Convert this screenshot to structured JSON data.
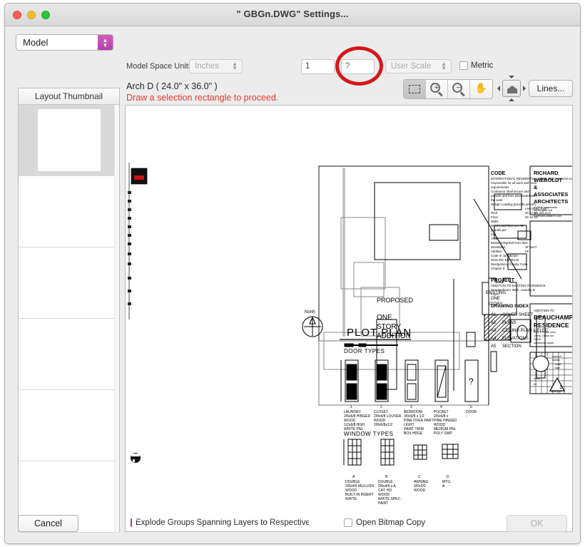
{
  "window": {
    "title": "\" GBGn.DWG\" Settings...",
    "traffic_lights": [
      "close-button",
      "minimize-button",
      "zoom-button"
    ]
  },
  "toolbar": {
    "layout_select_value": "Model",
    "model_space_units_label": "Model Space Units",
    "units_value": "Inches",
    "scale_numerator": "1",
    "scale_denominator": "?",
    "user_scale_value": "User Scale",
    "metric_label": "Metric",
    "metric_checked": false,
    "lines_button": "Lines...",
    "tools": [
      {
        "name": "selection-rectangle-tool",
        "active": true
      },
      {
        "name": "zoom-in-tool",
        "active": false
      },
      {
        "name": "zoom-out-tool",
        "active": false
      },
      {
        "name": "pan-tool",
        "active": false
      }
    ],
    "extents_tool": "zoom-to-extents"
  },
  "sheet": {
    "name": "Arch D ( 24.0\" x 36.0\" )",
    "hint": "Draw a selection rectangle to proceed.",
    "hint_color": "#ee3a2c"
  },
  "sidebar": {
    "header": "Layout Thumbnail",
    "rows": [
      {
        "selected": true
      },
      {
        "selected": false
      },
      {
        "selected": false
      },
      {
        "selected": false
      },
      {
        "selected": false
      },
      {
        "selected": false
      }
    ]
  },
  "footer": {
    "cancel_label": "Cancel",
    "ok_label": "OK",
    "ok_enabled": false,
    "explode_label": "Explode Groups Spanning Layers to Respective Layers",
    "explode_checked": true,
    "bitmap_label": "Open Bitmap Copy",
    "bitmap_checked": false
  },
  "annotation": {
    "type": "red-ellipse-highlight",
    "color": "#d5181a",
    "targets": "scale-denominator-field"
  },
  "drawing": {
    "plot_plan_title": "PLOT  PLAN",
    "proposed_label": "PROPOSED",
    "addition_line1": "ONE",
    "addition_line2": "STORY",
    "addition_line3": "ADDITION",
    "north_label": "North",
    "existing_one": "EXISTING",
    "existing_two": "ONE",
    "existing_three": "STORY",
    "door_types_title": "DOOR  TYPES",
    "window_types_title": "WINDOW  TYPES",
    "door_numbers": [
      "1",
      "2",
      "3",
      "4",
      "5"
    ],
    "door_names": [
      "LAUNDRY",
      "CLOSET",
      "BEDROOM",
      "POCKET",
      "DOOR"
    ],
    "window_letters": [
      "A",
      "B",
      "C",
      "D"
    ],
    "code_title": "CODE",
    "project_title": "PROJECT",
    "index_title": "DRAWING  INDEX",
    "index_items": [
      {
        "num": "A1",
        "label": "COVER  SHEET"
      },
      {
        "num": "A2",
        "label": "PLANS"
      },
      {
        "num": "A3",
        "label": "CEILING PLAN & ELEC"
      },
      {
        "num": "A4",
        "label": "ELEVATIONS"
      },
      {
        "num": "A5",
        "label": "SECTION"
      }
    ],
    "firm_lines": [
      "RICHARD",
      "WIEBOLDT",
      "&",
      "ASSOCIATES",
      "ARCHITECTS"
    ],
    "project_block_line1": "ADDITION  TO",
    "project_block_line2": "BEAUCHAMP",
    "project_block_line3": "RESIDENCE"
  }
}
